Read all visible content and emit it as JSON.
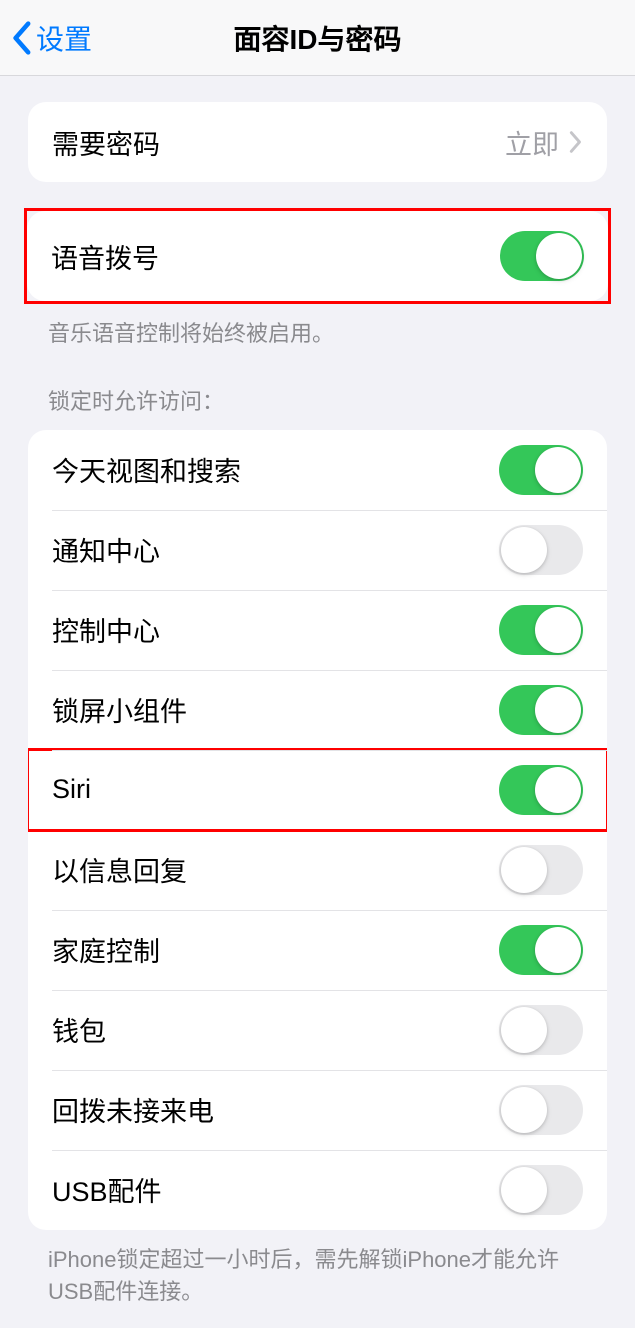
{
  "nav": {
    "back_label": "设置",
    "title": "面容ID与密码"
  },
  "require_password": {
    "label": "需要密码",
    "value": "立即"
  },
  "voice_dial": {
    "label": "语音拨号",
    "on": true,
    "footer": "音乐语音控制将始终被启用。"
  },
  "lock_section": {
    "header": "锁定时允许访问：",
    "items": [
      {
        "label": "今天视图和搜索",
        "on": true,
        "highlight": false
      },
      {
        "label": "通知中心",
        "on": false,
        "highlight": false
      },
      {
        "label": "控制中心",
        "on": true,
        "highlight": false
      },
      {
        "label": "锁屏小组件",
        "on": true,
        "highlight": false
      },
      {
        "label": "Siri",
        "on": true,
        "highlight": true
      },
      {
        "label": "以信息回复",
        "on": false,
        "highlight": false
      },
      {
        "label": "家庭控制",
        "on": true,
        "highlight": false
      },
      {
        "label": "钱包",
        "on": false,
        "highlight": false
      },
      {
        "label": "回拨未接来电",
        "on": false,
        "highlight": false
      },
      {
        "label": "USB配件",
        "on": false,
        "highlight": false
      }
    ],
    "footer": "iPhone锁定超过一小时后，需先解锁iPhone才能允许USB配件连接。"
  }
}
